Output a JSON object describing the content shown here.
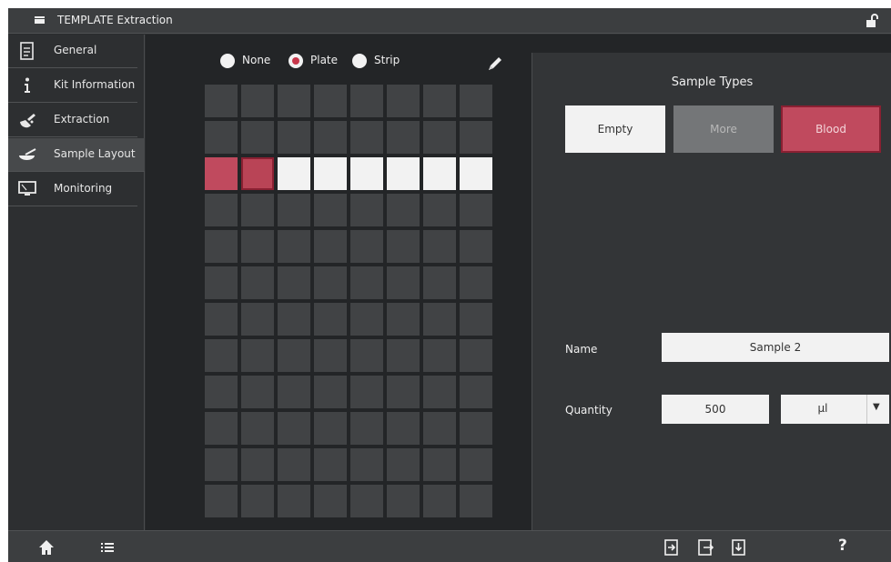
{
  "app": {
    "title": "TEMPLATE Extraction"
  },
  "sidebar": {
    "items": [
      {
        "label": "General",
        "icon": "document-icon"
      },
      {
        "label": "Kit Information",
        "icon": "info-icon"
      },
      {
        "label": "Extraction",
        "icon": "extraction-icon"
      },
      {
        "label": "Sample Layout",
        "icon": "sample-bowl-icon",
        "active": true
      },
      {
        "label": "Monitoring",
        "icon": "monitor-icon"
      }
    ]
  },
  "layout": {
    "options": [
      "None",
      "Plate",
      "Strip"
    ],
    "selected": "Plate",
    "rows": 12,
    "columns": 8,
    "filled_row": 3,
    "filled_row_wells": [
      "blood",
      "blood",
      "empty",
      "empty",
      "empty",
      "empty",
      "empty",
      "empty"
    ],
    "selected_well": 2
  },
  "sample_types": {
    "title": "Sample Types",
    "buttons": [
      "Empty",
      "More",
      "Blood"
    ],
    "selected": "Blood"
  },
  "form": {
    "name_label": "Name",
    "name_value": "Sample 2",
    "quantity_label": "Quantity",
    "quantity_value": "500",
    "unit_value": "µl"
  },
  "footer": {
    "help": "?"
  },
  "colors": {
    "accent_red": "#c04a5e",
    "empty_white": "#f2f2f2",
    "well_dark": "#414345"
  }
}
